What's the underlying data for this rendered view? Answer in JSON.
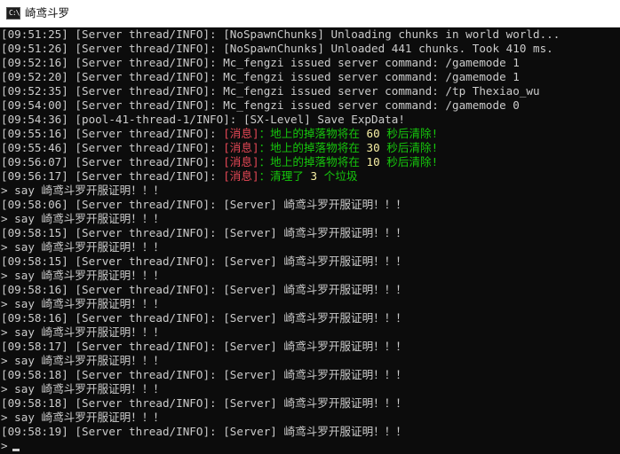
{
  "window": {
    "title": "崎鸢斗罗",
    "icon": "console-icon",
    "icon_glyph": "C:\\"
  },
  "console": {
    "lines": [
      {
        "text": "[09:51:25] [Server thread/INFO]: [NoSpawnChunks] Unloading chunks in world world..."
      },
      {
        "text": "[09:51:26] [Server thread/INFO]: [NoSpawnChunks] Unloaded 441 chunks. Took 410 ms."
      },
      {
        "text": "[09:52:16] [Server thread/INFO]: Mc_fengzi issued server command: /gamemode 1"
      },
      {
        "text": "[09:52:20] [Server thread/INFO]: Mc_fengzi issued server command: /gamemode 1"
      },
      {
        "text": "[09:52:35] [Server thread/INFO]: Mc_fengzi issued server command: /tp Thexiao_wu"
      },
      {
        "text": "[09:54:00] [Server thread/INFO]: Mc_fengzi issued server command: /gamemode 0"
      },
      {
        "text": "[09:54:36] [pool-41-thread-1/INFO]: [SX-Level] Save ExpData!"
      },
      {
        "prefix": "[09:55:16] [Server thread/INFO]: ",
        "tag": "[消息]",
        "message": "：地上的掉落物将在 60 秒后清除!"
      },
      {
        "prefix": "[09:55:46] [Server thread/INFO]: ",
        "tag": "[消息]",
        "message": "：地上的掉落物将在 30 秒后清除!"
      },
      {
        "prefix": "[09:56:07] [Server thread/INFO]: ",
        "tag": "[消息]",
        "message": "：地上的掉落物将在 10 秒后清除!"
      },
      {
        "prefix": "[09:56:17] [Server thread/INFO]: ",
        "tag": "[消息]",
        "message": "：清理了 3 个垃圾"
      },
      {
        "text": "> say 崎鸢斗罗开服证明！！！"
      },
      {
        "text": "[09:58:06] [Server thread/INFO]: [Server] 崎鸢斗罗开服证明！！！"
      },
      {
        "text": "> say 崎鸢斗罗开服证明！！！"
      },
      {
        "text": "[09:58:15] [Server thread/INFO]: [Server] 崎鸢斗罗开服证明！！！"
      },
      {
        "text": "> say 崎鸢斗罗开服证明！！！"
      },
      {
        "text": "[09:58:15] [Server thread/INFO]: [Server] 崎鸢斗罗开服证明！！！"
      },
      {
        "text": "> say 崎鸢斗罗开服证明！！！"
      },
      {
        "text": "[09:58:16] [Server thread/INFO]: [Server] 崎鸢斗罗开服证明！！！"
      },
      {
        "text": "> say 崎鸢斗罗开服证明！！！"
      },
      {
        "text": "[09:58:16] [Server thread/INFO]: [Server] 崎鸢斗罗开服证明！！！"
      },
      {
        "text": "> say 崎鸢斗罗开服证明！！！"
      },
      {
        "text": "[09:58:17] [Server thread/INFO]: [Server] 崎鸢斗罗开服证明！！！"
      },
      {
        "text": "> say 崎鸢斗罗开服证明！！！"
      },
      {
        "text": "[09:58:18] [Server thread/INFO]: [Server] 崎鸢斗罗开服证明！！！"
      },
      {
        "text": "> say 崎鸢斗罗开服证明！！！"
      },
      {
        "text": "[09:58:18] [Server thread/INFO]: [Server] 崎鸢斗罗开服证明！！！"
      },
      {
        "text": "> say 崎鸢斗罗开服证明！！！"
      },
      {
        "text": "[09:58:19] [Server thread/INFO]: [Server] 崎鸢斗罗开服证明！！！"
      },
      {
        "text": "> "
      }
    ]
  },
  "colors": {
    "background": "#0c0c0c",
    "text": "#cccccc",
    "tag": "#e74856",
    "message": "#16c60c",
    "number": "#f9f1a5",
    "titlebar": "#ffffff"
  }
}
